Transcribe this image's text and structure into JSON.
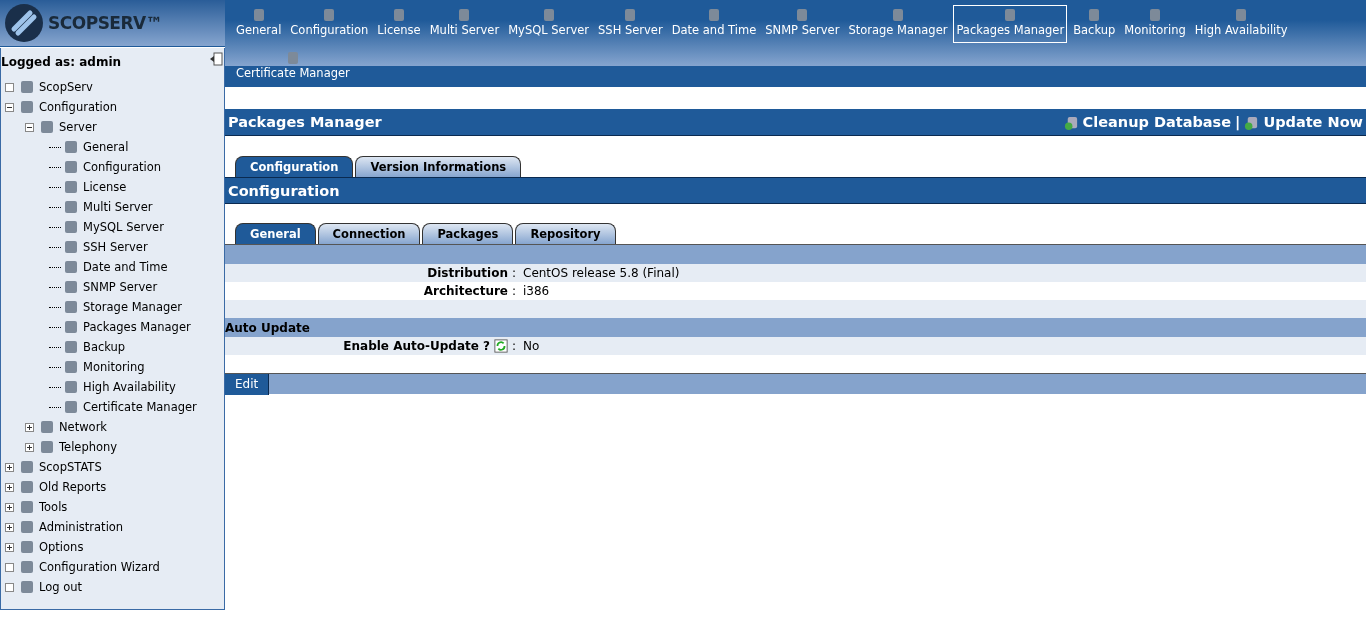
{
  "logo": {
    "text": "SCOPSERV™"
  },
  "topnav": [
    {
      "label": "General",
      "selected": false
    },
    {
      "label": "Configuration",
      "selected": false
    },
    {
      "label": "License",
      "selected": false
    },
    {
      "label": "Multi Server",
      "selected": false
    },
    {
      "label": "MySQL Server",
      "selected": false
    },
    {
      "label": "SSH Server",
      "selected": false
    },
    {
      "label": "Date and Time",
      "selected": false
    },
    {
      "label": "SNMP Server",
      "selected": false
    },
    {
      "label": "Storage Manager",
      "selected": false
    },
    {
      "label": "Packages Manager",
      "selected": true
    },
    {
      "label": "Backup",
      "selected": false
    },
    {
      "label": "Monitoring",
      "selected": false
    },
    {
      "label": "High Availability",
      "selected": false
    },
    {
      "label": "Certificate Manager",
      "selected": false
    }
  ],
  "sidebar": {
    "user": "Logged as: admin",
    "tree": [
      {
        "label": "ScopServ",
        "kind": "empty"
      },
      {
        "label": "Configuration",
        "kind": "expanded",
        "children": [
          {
            "label": "Server",
            "kind": "expanded",
            "children": [
              {
                "label": "General",
                "kind": "leaf"
              },
              {
                "label": "Configuration",
                "kind": "leaf"
              },
              {
                "label": "License",
                "kind": "leaf"
              },
              {
                "label": "Multi Server",
                "kind": "leaf"
              },
              {
                "label": "MySQL Server",
                "kind": "leaf"
              },
              {
                "label": "SSH Server",
                "kind": "leaf"
              },
              {
                "label": "Date and Time",
                "kind": "leaf"
              },
              {
                "label": "SNMP Server",
                "kind": "leaf"
              },
              {
                "label": "Storage Manager",
                "kind": "leaf"
              },
              {
                "label": "Packages Manager",
                "kind": "leaf"
              },
              {
                "label": "Backup",
                "kind": "leaf"
              },
              {
                "label": "Monitoring",
                "kind": "leaf"
              },
              {
                "label": "High Availability",
                "kind": "leaf"
              },
              {
                "label": "Certificate Manager",
                "kind": "leaf"
              }
            ]
          },
          {
            "label": "Network",
            "kind": "collapsed"
          },
          {
            "label": "Telephony",
            "kind": "collapsed"
          }
        ]
      },
      {
        "label": "ScopSTATS",
        "kind": "collapsed"
      },
      {
        "label": "Old Reports",
        "kind": "collapsed"
      },
      {
        "label": "Tools",
        "kind": "collapsed"
      },
      {
        "label": "Administration",
        "kind": "collapsed"
      },
      {
        "label": "Options",
        "kind": "collapsed"
      },
      {
        "label": "Configuration Wizard",
        "kind": "empty"
      },
      {
        "label": "Log out",
        "kind": "empty"
      }
    ]
  },
  "page": {
    "title": "Packages Manager",
    "actions": [
      "Cleanup Database",
      "Update Now"
    ],
    "separator": "|",
    "tabs": [
      {
        "label": "Configuration",
        "selected": true
      },
      {
        "label": "Version Informations",
        "selected": false
      }
    ],
    "section_title": "Configuration",
    "subtabs": [
      {
        "label": "General",
        "selected": true
      },
      {
        "label": "Connection",
        "selected": false
      },
      {
        "label": "Packages",
        "selected": false
      },
      {
        "label": "Repository",
        "selected": false
      }
    ],
    "field_separator": ":",
    "fields": [
      {
        "label": "Distribution",
        "value": "CentOS release 5.8 (Final)"
      },
      {
        "label": "Architecture",
        "value": "i386"
      }
    ],
    "auto_update": {
      "heading": "Auto Update",
      "label": "Enable Auto-Update ?",
      "value": "No"
    },
    "edit_button": "Edit"
  }
}
